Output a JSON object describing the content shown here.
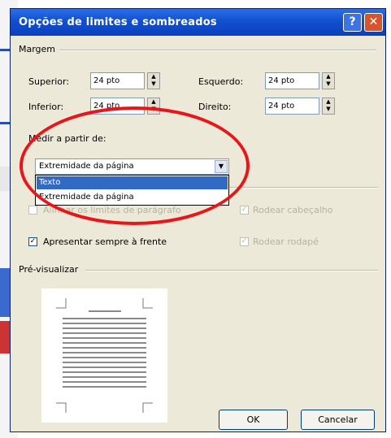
{
  "window": {
    "title": "Opções de limites e sombreados",
    "help_label": "?",
    "close_label": "✕"
  },
  "margins": {
    "section_label": "Margem",
    "top": {
      "label": "Superior:",
      "value": "24 pto"
    },
    "left": {
      "label": "Esquerdo:",
      "value": "24 pto"
    },
    "bottom": {
      "label": "Inferior:",
      "value": "24 pto"
    },
    "right": {
      "label": "Direito:",
      "value": "24 pto"
    }
  },
  "measure": {
    "label": "Medir a partir de:",
    "selected": "Extremidade da página",
    "options": [
      "Texto",
      "Extremidade da página"
    ]
  },
  "options": {
    "align_paragraph": {
      "label": "Alinhar os limites de parágrafo",
      "checked": false,
      "enabled": false
    },
    "surround_header": {
      "label": "Rodear cabeçalho",
      "checked": true,
      "enabled": false
    },
    "always_front": {
      "label": "Apresentar sempre à frente",
      "checked": true,
      "enabled": true
    },
    "surround_footer": {
      "label": "Rodear rodapé",
      "checked": true,
      "enabled": false
    }
  },
  "preview": {
    "label": "Pré-visualizar"
  },
  "buttons": {
    "ok": "OK",
    "cancel": "Cancelar"
  },
  "colors": {
    "title_bar": "#0a3fbd",
    "dialog_bg": "#ece9d8",
    "highlight": "#316ac5",
    "annotation": "#e8161b"
  },
  "icons": {
    "help": "question-mark-icon",
    "close": "close-icon",
    "spin": "spin-arrows-icon",
    "dropdown": "chevron-down-icon"
  }
}
